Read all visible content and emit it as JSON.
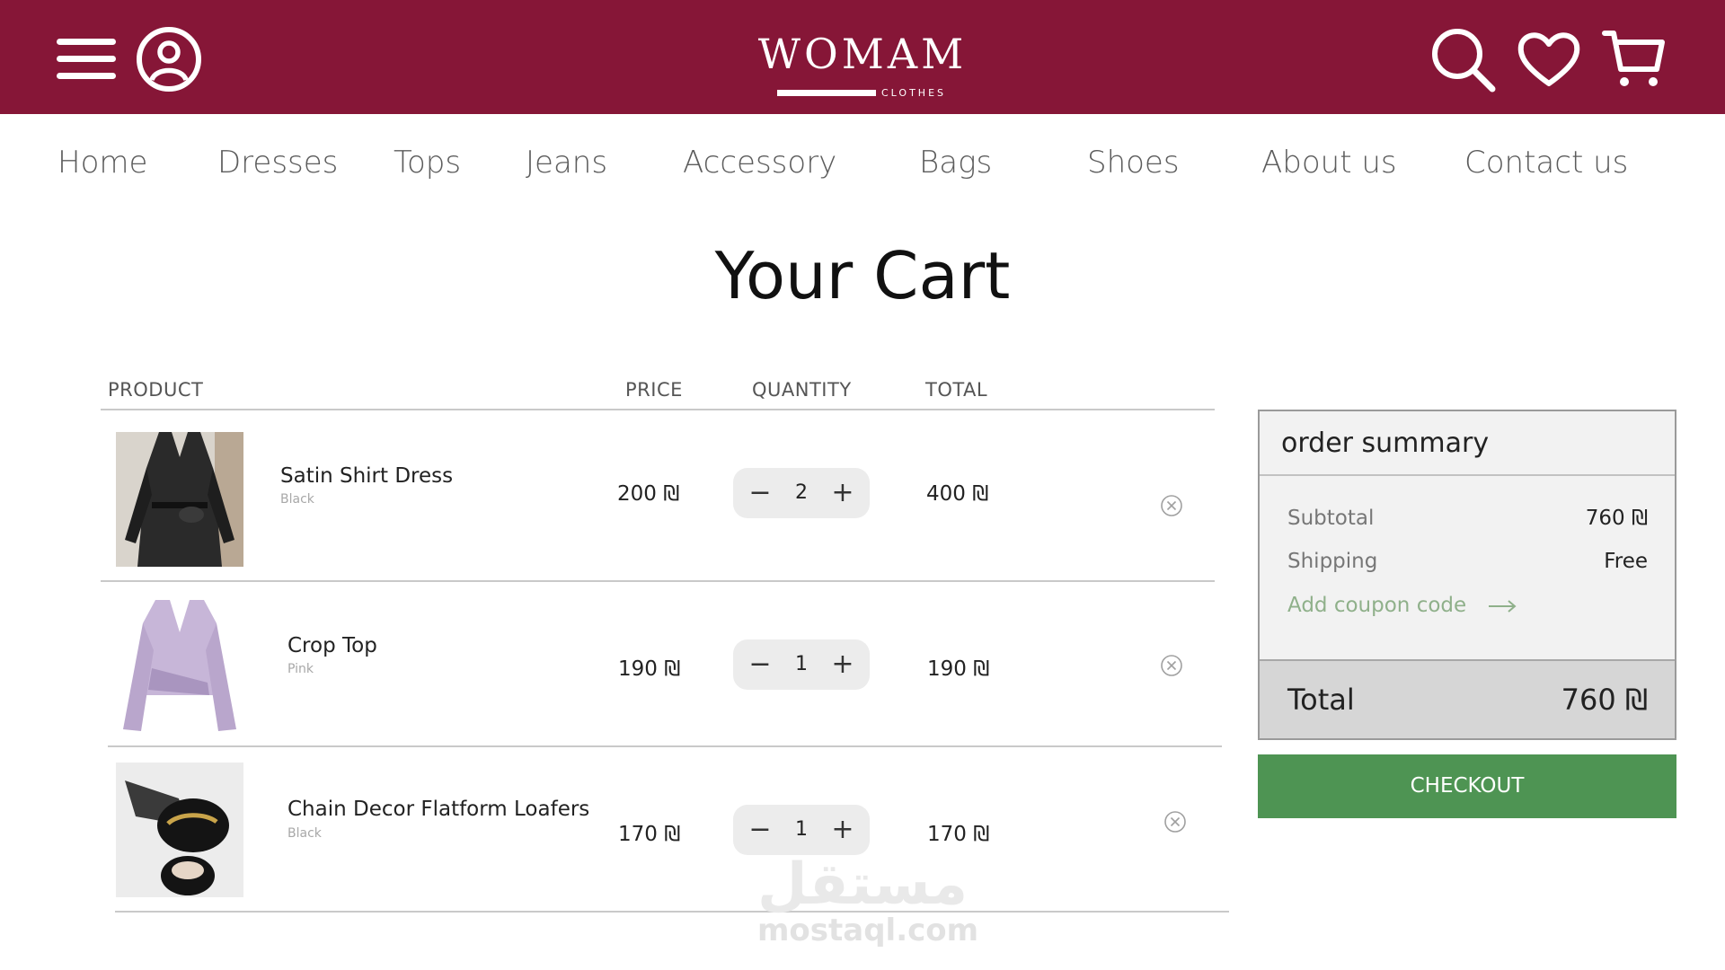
{
  "header": {
    "logo_word": "WOMAM",
    "logo_sub": "CLOTHES",
    "icons": [
      "menu-icon",
      "user-icon",
      "search-icon",
      "heart-icon",
      "cart-icon"
    ]
  },
  "nav": [
    "Home",
    "Dresses",
    "Tops",
    "Jeans",
    "Accessory",
    "Bags",
    "Shoes",
    "About us",
    "Contact us"
  ],
  "page_title": "Your Cart",
  "table": {
    "headers": [
      "PRODUCT",
      "PRICE",
      "QUANTITY",
      "TOTAL"
    ]
  },
  "items": [
    {
      "name": "Satin Shirt Dress",
      "color": "Black",
      "price": "200 ₪",
      "quantity": "2",
      "total": "400 ₪"
    },
    {
      "name": "Crop Top",
      "color": "Pink",
      "price": "190 ₪",
      "quantity": "1",
      "total": "190 ₪"
    },
    {
      "name": "Chain Decor Flatform Loafers",
      "color": "Black",
      "price": "170 ₪",
      "quantity": "1",
      "total": "170 ₪"
    }
  ],
  "summary": {
    "title": "order summary",
    "subtotal_label": "Subtotal",
    "subtotal_value": "760 ₪",
    "shipping_label": "Shipping",
    "shipping_value": "Free",
    "coupon": "Add coupon code",
    "total_label": "Total",
    "total_value": "760 ₪"
  },
  "checkout_label": "CHECKOUT",
  "watermark": {
    "arabic": "مستقل",
    "latin": "mostaql.com"
  },
  "colors": {
    "brand": "#861637",
    "checkout": "#4e9453",
    "coupon": "#8fb08a"
  }
}
